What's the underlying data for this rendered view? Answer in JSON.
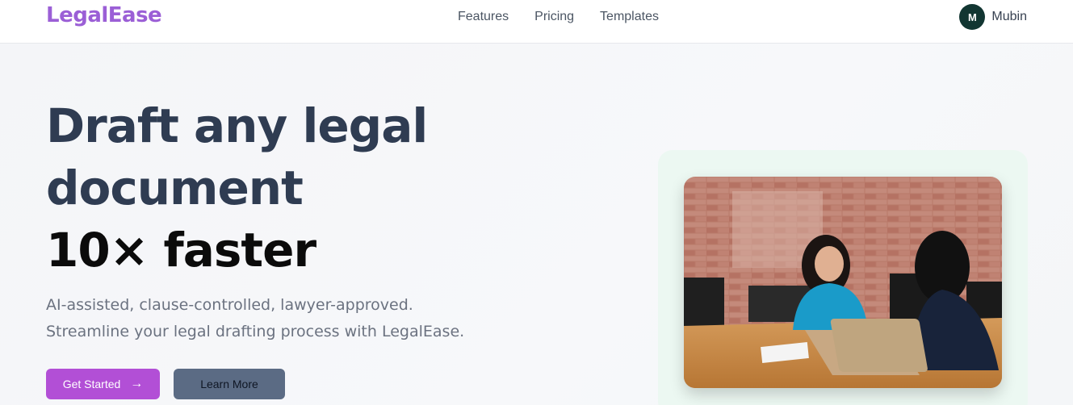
{
  "header": {
    "logo": "LegalEase",
    "nav": [
      "Features",
      "Pricing",
      "Templates"
    ],
    "user": {
      "initial": "M",
      "name": "Mubin"
    }
  },
  "hero": {
    "headline_line1": "Draft any legal",
    "headline_line2": "document",
    "headline_line3": "10× faster",
    "sub_line1": "AI-assisted, clause-controlled, lawyer-approved.",
    "sub_line2": "Streamline your legal drafting process with LegalEase.",
    "primary_button": "Get Started",
    "primary_icon": "arrow-right-icon",
    "secondary_button": "Learn More"
  },
  "colors": {
    "brand": "#9b5fd6",
    "primary_button": "#b24fd6",
    "secondary_button": "#5b6b84",
    "avatar": "#123632"
  }
}
